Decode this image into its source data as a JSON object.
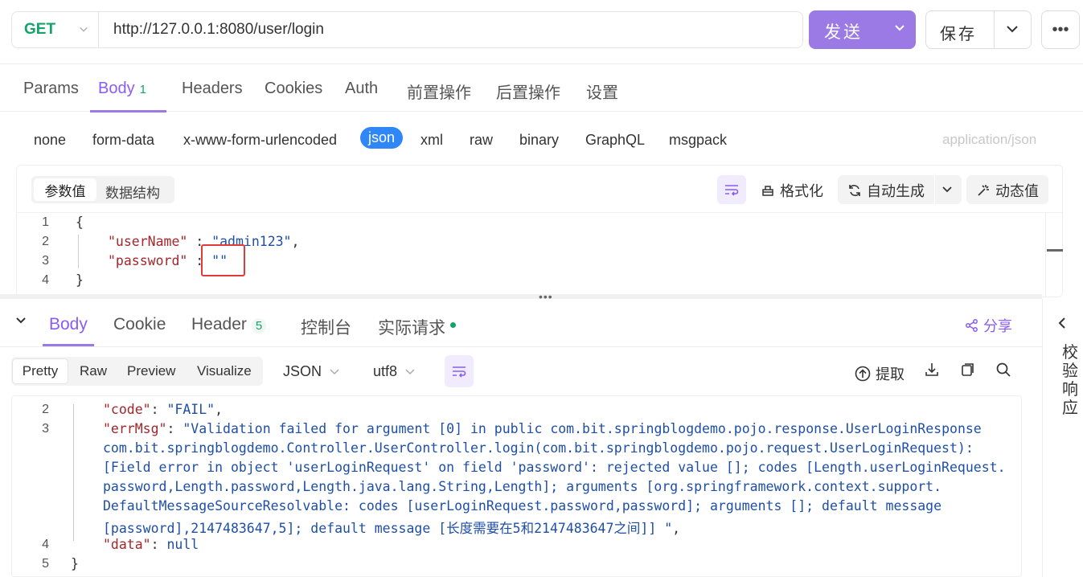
{
  "request": {
    "method": "GET",
    "url": "http://127.0.0.1:8080/user/login",
    "send_label": "发送",
    "save_label": "保存",
    "more_label": "•••"
  },
  "request_tabs": [
    {
      "label": "Params"
    },
    {
      "label": "Body",
      "count": "1"
    },
    {
      "label": "Headers"
    },
    {
      "label": "Cookies"
    },
    {
      "label": "Auth"
    },
    {
      "label": "前置操作"
    },
    {
      "label": "后置操作"
    },
    {
      "label": "设置"
    }
  ],
  "body_types": [
    "none",
    "form-data",
    "x-www-form-urlencoded",
    "json",
    "xml",
    "raw",
    "binary",
    "GraphQL",
    "msgpack"
  ],
  "content_type": "application/json",
  "editor": {
    "seg_values": "参数值",
    "seg_schema": "数据结构",
    "format_label": "格式化",
    "autogen_label": "自动生成",
    "dynamic_label": "动态值",
    "line_numbers": [
      "1",
      "2",
      "3",
      "4"
    ],
    "lines": {
      "l1": "{",
      "l2_key": "\"userName\"",
      "l2_sep": " : ",
      "l2_val": "\"admin123\"",
      "l2_end": ",",
      "l3_key": "\"password\"",
      "l3_sep": " : ",
      "l3_val": "\"\"",
      "l4": "}"
    }
  },
  "response": {
    "tabs": [
      {
        "label": "Body"
      },
      {
        "label": "Cookie"
      },
      {
        "label": "Header",
        "count": "5"
      },
      {
        "label": "控制台"
      },
      {
        "label": "实际请求"
      }
    ],
    "share_label": "分享",
    "views": [
      "Pretty",
      "Raw",
      "Preview",
      "Visualize"
    ],
    "format": "JSON",
    "encoding": "utf8",
    "extract_label": "提取",
    "line_numbers": {
      "a": "2",
      "b": "3",
      "c": "4",
      "d": "5"
    },
    "lines": {
      "l2_key": "\"code\"",
      "l2_rest": ": ",
      "l2_val": "\"FAIL\"",
      "l2_end": ",",
      "l3_key": "\"errMsg\"",
      "l3_rest": ": ",
      "l3_val1": "\"Validation failed for argument [0] in public com.bit.springblogdemo.pojo.response.UserLoginResponse",
      "l3_val2": "com.bit.springblogdemo.Controller.UserController.login(com.bit.springblogdemo.pojo.request.UserLoginRequest):",
      "l3_val3": "[Field error in object 'userLoginRequest' on field 'password': rejected value []; codes [Length.userLoginRequest.",
      "l3_val4": "password,Length.password,Length.java.lang.String,Length]; arguments [org.springframework.context.support.",
      "l3_val5": "DefaultMessageSourceResolvable: codes [userLoginRequest.password,password]; arguments []; default message",
      "l3_val6": "[password],2147483647,5]; default message [长度需要在5和2147483647之间]] \"",
      "l3_end": ",",
      "l4_key": "\"data\"",
      "l4_rest": ": ",
      "l4_val": "null",
      "l5": "}"
    }
  },
  "side_panel_label": "校验响应",
  "colors": {
    "accent": "#9b7ae6",
    "active_tab": "#8a5cf5",
    "method_get": "#13a36b",
    "json_key": "#a3262a",
    "json_string": "#1e4fa8",
    "highlight_box": "#e03b3b"
  }
}
